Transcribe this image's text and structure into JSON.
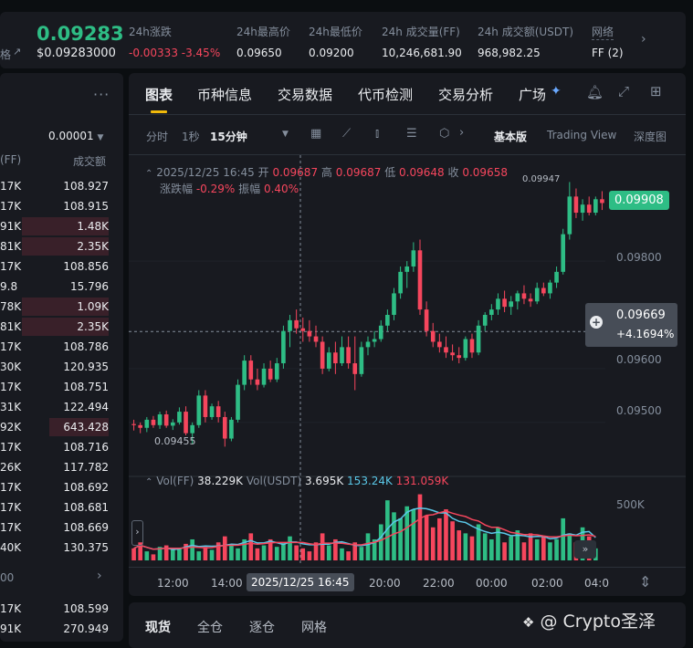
{
  "ticker": {
    "left_cut_label": "格",
    "price": "0.09283",
    "price_usd": "$0.09283000",
    "stats": [
      {
        "label": "24h涨跌",
        "value": "-0.00333 -3.45%",
        "color": "#f6465d"
      },
      {
        "label": "24h最高价",
        "value": "0.09650",
        "color": "#eaecef"
      },
      {
        "label": "24h最低价",
        "value": "0.09200",
        "color": "#eaecef"
      },
      {
        "label": "24h 成交量(FF)",
        "value": "10,246,681.90",
        "color": "#eaecef"
      },
      {
        "label": "24h 成交额(USDT)",
        "value": "968,982.25",
        "color": "#eaecef"
      }
    ],
    "network_label": "网络",
    "network_value": "FF (2)"
  },
  "orderbook": {
    "precision": "0.00001",
    "col_qty": "(FF)",
    "col_total": "成交额",
    "rows": [
      {
        "qty": "17K",
        "total": "108.927",
        "depth": 0
      },
      {
        "qty": "17K",
        "total": "108.915",
        "depth": 0
      },
      {
        "qty": "91K",
        "total": "1.48K",
        "depth": 0.95
      },
      {
        "qty": "81K",
        "total": "2.35K",
        "depth": 0.95
      },
      {
        "qty": "17K",
        "total": "108.856",
        "depth": 0
      },
      {
        "qty": "9.8",
        "total": "15.796",
        "depth": 0
      },
      {
        "qty": "78K",
        "total": "1.09K",
        "depth": 0.95
      },
      {
        "qty": "81K",
        "total": "2.35K",
        "depth": 0.95
      },
      {
        "qty": "17K",
        "total": "108.786",
        "depth": 0
      },
      {
        "qty": "30K",
        "total": "120.935",
        "depth": 0
      },
      {
        "qty": "17K",
        "total": "108.751",
        "depth": 0
      },
      {
        "qty": "31K",
        "total": "122.494",
        "depth": 0
      },
      {
        "qty": "92K",
        "total": "643.428",
        "depth": 0.65
      },
      {
        "qty": "17K",
        "total": "108.716",
        "depth": 0
      },
      {
        "qty": "26K",
        "total": "117.782",
        "depth": 0
      },
      {
        "qty": "17K",
        "total": "108.692",
        "depth": 0
      },
      {
        "qty": "17K",
        "total": "108.681",
        "depth": 0
      },
      {
        "qty": "17K",
        "total": "108.669",
        "depth": 0
      },
      {
        "qty": "40K",
        "total": "130.375",
        "depth": 0
      }
    ],
    "bottom_label": "00",
    "bottom_rows": [
      {
        "qty": "17K",
        "total": "108.599"
      },
      {
        "qty": "91K",
        "total": "270.949"
      }
    ]
  },
  "chart_tabs": [
    "图表",
    "币种信息",
    "交易数据",
    "代币检测",
    "交易分析",
    "广场"
  ],
  "toolbar": {
    "intervals": [
      "分时",
      "1秒",
      "15分钟"
    ],
    "views": [
      "基本版",
      "Trading View",
      "深度图"
    ]
  },
  "ohlc": {
    "datetime": "2025/12/25 16:45",
    "open_label": "开",
    "open": "0.09687",
    "high_label": "高",
    "high": "0.09687",
    "low_label": "低",
    "low": "0.09648",
    "close_label": "收",
    "close": "0.09658",
    "change_label": "涨跌幅",
    "change": "-0.29%",
    "amp_label": "振幅",
    "amp": "0.40%"
  },
  "price_axis": {
    "current": "0.09908",
    "ticks": [
      "0.09800",
      "0.09600",
      "0.09500"
    ],
    "crosshair_price": "0.09669",
    "crosshair_pct": "+4.1694%",
    "high_marker": "0.09947",
    "low_marker": "0.09455"
  },
  "volume": {
    "label": "Vol(FF)",
    "ff": "38.229K",
    "usdt_label": "Vol(USDT)",
    "usdt": "3.695K",
    "ma1": "153.24K",
    "ma2": "131.059K",
    "axis": "500K"
  },
  "time_axis": {
    "ticks": [
      "12:00",
      "14:00",
      "20:00",
      "22:00",
      "00:00",
      "02:00",
      "04:0"
    ],
    "crosshair": "2025/12/25 16:45"
  },
  "bottom_tabs": [
    "现货",
    "全仓",
    "逐仓",
    "网格"
  ],
  "watermark": "@ Crypto圣泽",
  "colors": {
    "up": "#2ebd85",
    "down": "#f6465d",
    "accent": "#f0b90b",
    "ma1": "#5ac8e8",
    "ma2": "#f6465d"
  },
  "chart_data": {
    "type": "candlestick",
    "x_ticks": [
      "12:00",
      "14:00",
      "20:00",
      "22:00",
      "00:00",
      "02:00"
    ],
    "candles": [
      [
        0.09497,
        0.09505,
        0.09485,
        0.09495
      ],
      [
        0.09495,
        0.095,
        0.0948,
        0.0949
      ],
      [
        0.0949,
        0.0951,
        0.09482,
        0.09505
      ],
      [
        0.09505,
        0.09512,
        0.0949,
        0.09495
      ],
      [
        0.09495,
        0.0952,
        0.09488,
        0.09515
      ],
      [
        0.09515,
        0.09522,
        0.0949,
        0.09494
      ],
      [
        0.09494,
        0.09506,
        0.09486,
        0.095
      ],
      [
        0.095,
        0.09528,
        0.09496,
        0.0952
      ],
      [
        0.0952,
        0.0953,
        0.09476,
        0.0948
      ],
      [
        0.0948,
        0.095,
        0.0946,
        0.09495
      ],
      [
        0.09495,
        0.0956,
        0.0949,
        0.0955
      ],
      [
        0.0955,
        0.0956,
        0.095,
        0.0951
      ],
      [
        0.0951,
        0.09535,
        0.09505,
        0.0953
      ],
      [
        0.0953,
        0.0954,
        0.095,
        0.0951
      ],
      [
        0.0951,
        0.0952,
        0.09455,
        0.0947
      ],
      [
        0.0947,
        0.0951,
        0.09465,
        0.09505
      ],
      [
        0.09505,
        0.0958,
        0.095,
        0.0957
      ],
      [
        0.0957,
        0.09625,
        0.0956,
        0.09615
      ],
      [
        0.09615,
        0.09625,
        0.0957,
        0.0958
      ],
      [
        0.0958,
        0.096,
        0.0956,
        0.0957
      ],
      [
        0.0957,
        0.0961,
        0.09565,
        0.096
      ],
      [
        0.096,
        0.09615,
        0.09575,
        0.0958
      ],
      [
        0.0958,
        0.0962,
        0.09575,
        0.0961
      ],
      [
        0.0961,
        0.0968,
        0.096,
        0.0967
      ],
      [
        0.0967,
        0.097,
        0.0964,
        0.0969
      ],
      [
        0.0969,
        0.0971,
        0.09665,
        0.09675
      ],
      [
        0.09675,
        0.09695,
        0.0965,
        0.0967
      ],
      [
        0.0967,
        0.0969,
        0.0965,
        0.0966
      ],
      [
        0.0966,
        0.0968,
        0.0964,
        0.0965
      ],
      [
        0.0965,
        0.0966,
        0.0959,
        0.096
      ],
      [
        0.096,
        0.0964,
        0.09595,
        0.0963
      ],
      [
        0.0963,
        0.0965,
        0.0959,
        0.0961
      ],
      [
        0.0961,
        0.0966,
        0.09605,
        0.0964
      ],
      [
        0.0964,
        0.0966,
        0.096,
        0.0961
      ],
      [
        0.0961,
        0.0966,
        0.0956,
        0.0959
      ],
      [
        0.0959,
        0.0965,
        0.09585,
        0.0964
      ],
      [
        0.0964,
        0.0966,
        0.09625,
        0.0965
      ],
      [
        0.0965,
        0.0967,
        0.0964,
        0.09655
      ],
      [
        0.09655,
        0.0969,
        0.0965,
        0.0968
      ],
      [
        0.0968,
        0.0971,
        0.0967,
        0.097
      ],
      [
        0.097,
        0.0975,
        0.0969,
        0.0974
      ],
      [
        0.0974,
        0.0979,
        0.0973,
        0.0978
      ],
      [
        0.0978,
        0.098,
        0.0975,
        0.0979
      ],
      [
        0.0979,
        0.09835,
        0.0978,
        0.0982
      ],
      [
        0.0982,
        0.0984,
        0.097,
        0.0971
      ],
      [
        0.0971,
        0.09725,
        0.0966,
        0.0967
      ],
      [
        0.0967,
        0.09685,
        0.0964,
        0.0965
      ],
      [
        0.0965,
        0.09665,
        0.0963,
        0.0964
      ],
      [
        0.0964,
        0.0966,
        0.0962,
        0.0963
      ],
      [
        0.0963,
        0.09645,
        0.09615,
        0.09625
      ],
      [
        0.09625,
        0.0964,
        0.0961,
        0.0962
      ],
      [
        0.0962,
        0.0966,
        0.09615,
        0.09655
      ],
      [
        0.09655,
        0.09665,
        0.0962,
        0.0963
      ],
      [
        0.0963,
        0.0969,
        0.09625,
        0.0968
      ],
      [
        0.0968,
        0.09705,
        0.0967,
        0.097
      ],
      [
        0.097,
        0.0972,
        0.0969,
        0.0971
      ],
      [
        0.0971,
        0.0974,
        0.097,
        0.0973
      ],
      [
        0.0973,
        0.09745,
        0.09705,
        0.09715
      ],
      [
        0.09715,
        0.09735,
        0.097,
        0.09725
      ],
      [
        0.09725,
        0.09745,
        0.0971,
        0.0974
      ],
      [
        0.0974,
        0.09755,
        0.0972,
        0.0973
      ],
      [
        0.0973,
        0.0974,
        0.09715,
        0.09725
      ],
      [
        0.09725,
        0.0976,
        0.0972,
        0.0975
      ],
      [
        0.0975,
        0.0976,
        0.09735,
        0.0974
      ],
      [
        0.0974,
        0.09765,
        0.0973,
        0.0976
      ],
      [
        0.0976,
        0.0979,
        0.0975,
        0.0978
      ],
      [
        0.0978,
        0.0986,
        0.09775,
        0.0985
      ],
      [
        0.0985,
        0.09947,
        0.0984,
        0.0992
      ],
      [
        0.0992,
        0.09935,
        0.0988,
        0.0989
      ],
      [
        0.0989,
        0.09915,
        0.09875,
        0.09905
      ],
      [
        0.09905,
        0.0992,
        0.09885,
        0.0989
      ],
      [
        0.0989,
        0.0992,
        0.09885,
        0.09915
      ],
      [
        0.09915,
        0.0993,
        0.09895,
        0.09908
      ]
    ],
    "volumes": [
      40,
      60,
      30,
      20,
      45,
      50,
      35,
      40,
      55,
      70,
      30,
      45,
      35,
      60,
      80,
      50,
      40,
      70,
      90,
      40,
      50,
      70,
      45,
      60,
      80,
      50,
      40,
      30,
      60,
      90,
      50,
      70,
      40,
      30,
      60,
      45,
      90,
      70,
      120,
      200,
      160,
      140,
      180,
      170,
      220,
      150,
      110,
      140,
      170,
      130,
      100,
      90,
      80,
      120,
      90,
      70,
      110,
      60,
      80,
      100,
      60,
      90,
      70,
      80,
      60,
      70,
      140,
      90,
      60,
      110,
      80,
      40
    ],
    "ylim": [
      0.0942,
      0.0998
    ]
  }
}
